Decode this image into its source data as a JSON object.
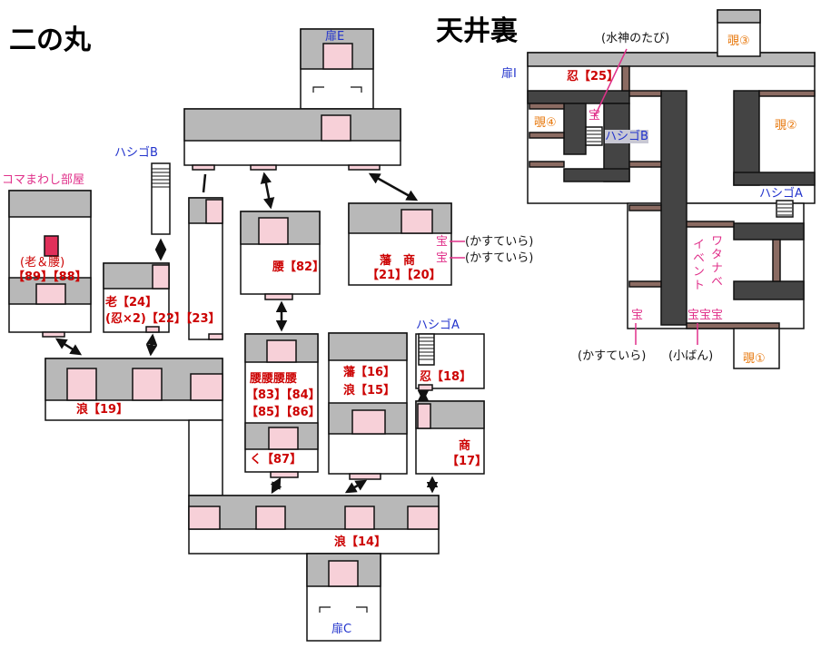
{
  "titles": {
    "left": "二の丸",
    "right": "天井裏"
  },
  "colors": {
    "room_fill": "#b8b8b8",
    "door_fill": "#f7d0d8",
    "dark_wall": "#444444",
    "brown_wall": "#8b6b62",
    "boss_marker": "#e0305a",
    "red": "#cc0000",
    "blue": "#2233cc",
    "pink": "#e0308a",
    "orange": "#e87a10"
  },
  "left": {
    "door_e": "扉E",
    "door_c": "扉C",
    "koma_room": "コマまわし部屋",
    "koma_a": "(老＆腰)",
    "koma_b": "【89】【88】",
    "hashigo_b": "ハシゴB",
    "hashigo_a": "ハシゴA",
    "ro24": "老【24】",
    "ro24b": "(忍×2)【22】【23】",
    "yoshi82": "腰【82】",
    "han": "藩　商",
    "han_n": "【21】【20】",
    "treasure1": "宝",
    "treasure1_note": "(かすていら)",
    "treasure2": "宝",
    "treasure2_note": "(かすていら)",
    "koshi_a": "腰腰腰腰",
    "koshi_b": "【83】【84】",
    "koshi_c": "【85】【86】",
    "ku87": "く【87】",
    "han16": "藩【16】",
    "ro15": "浪【15】",
    "nin18": "忍【18】",
    "sho": "商",
    "sho17": "【17】",
    "ro19": "浪【19】",
    "ro14": "浪【14】"
  },
  "right": {
    "door_i": "扉I",
    "nin25": "忍【25】",
    "suijin": "(水神のたび)",
    "nozoki1": "覗①",
    "nozoki2": "覗②",
    "nozoki3": "覗③",
    "nozoki4": "覗④",
    "treasure_top": "宝",
    "hashigo_b": "ハシゴB",
    "hashigo_a": "ハシゴA",
    "watanabe": "ワタナベ",
    "event": "イベント",
    "treasure_bottom": "宝",
    "treasure_trio": "宝宝宝",
    "kasutera": "(かすていら)",
    "koban": "(小ばん)"
  }
}
